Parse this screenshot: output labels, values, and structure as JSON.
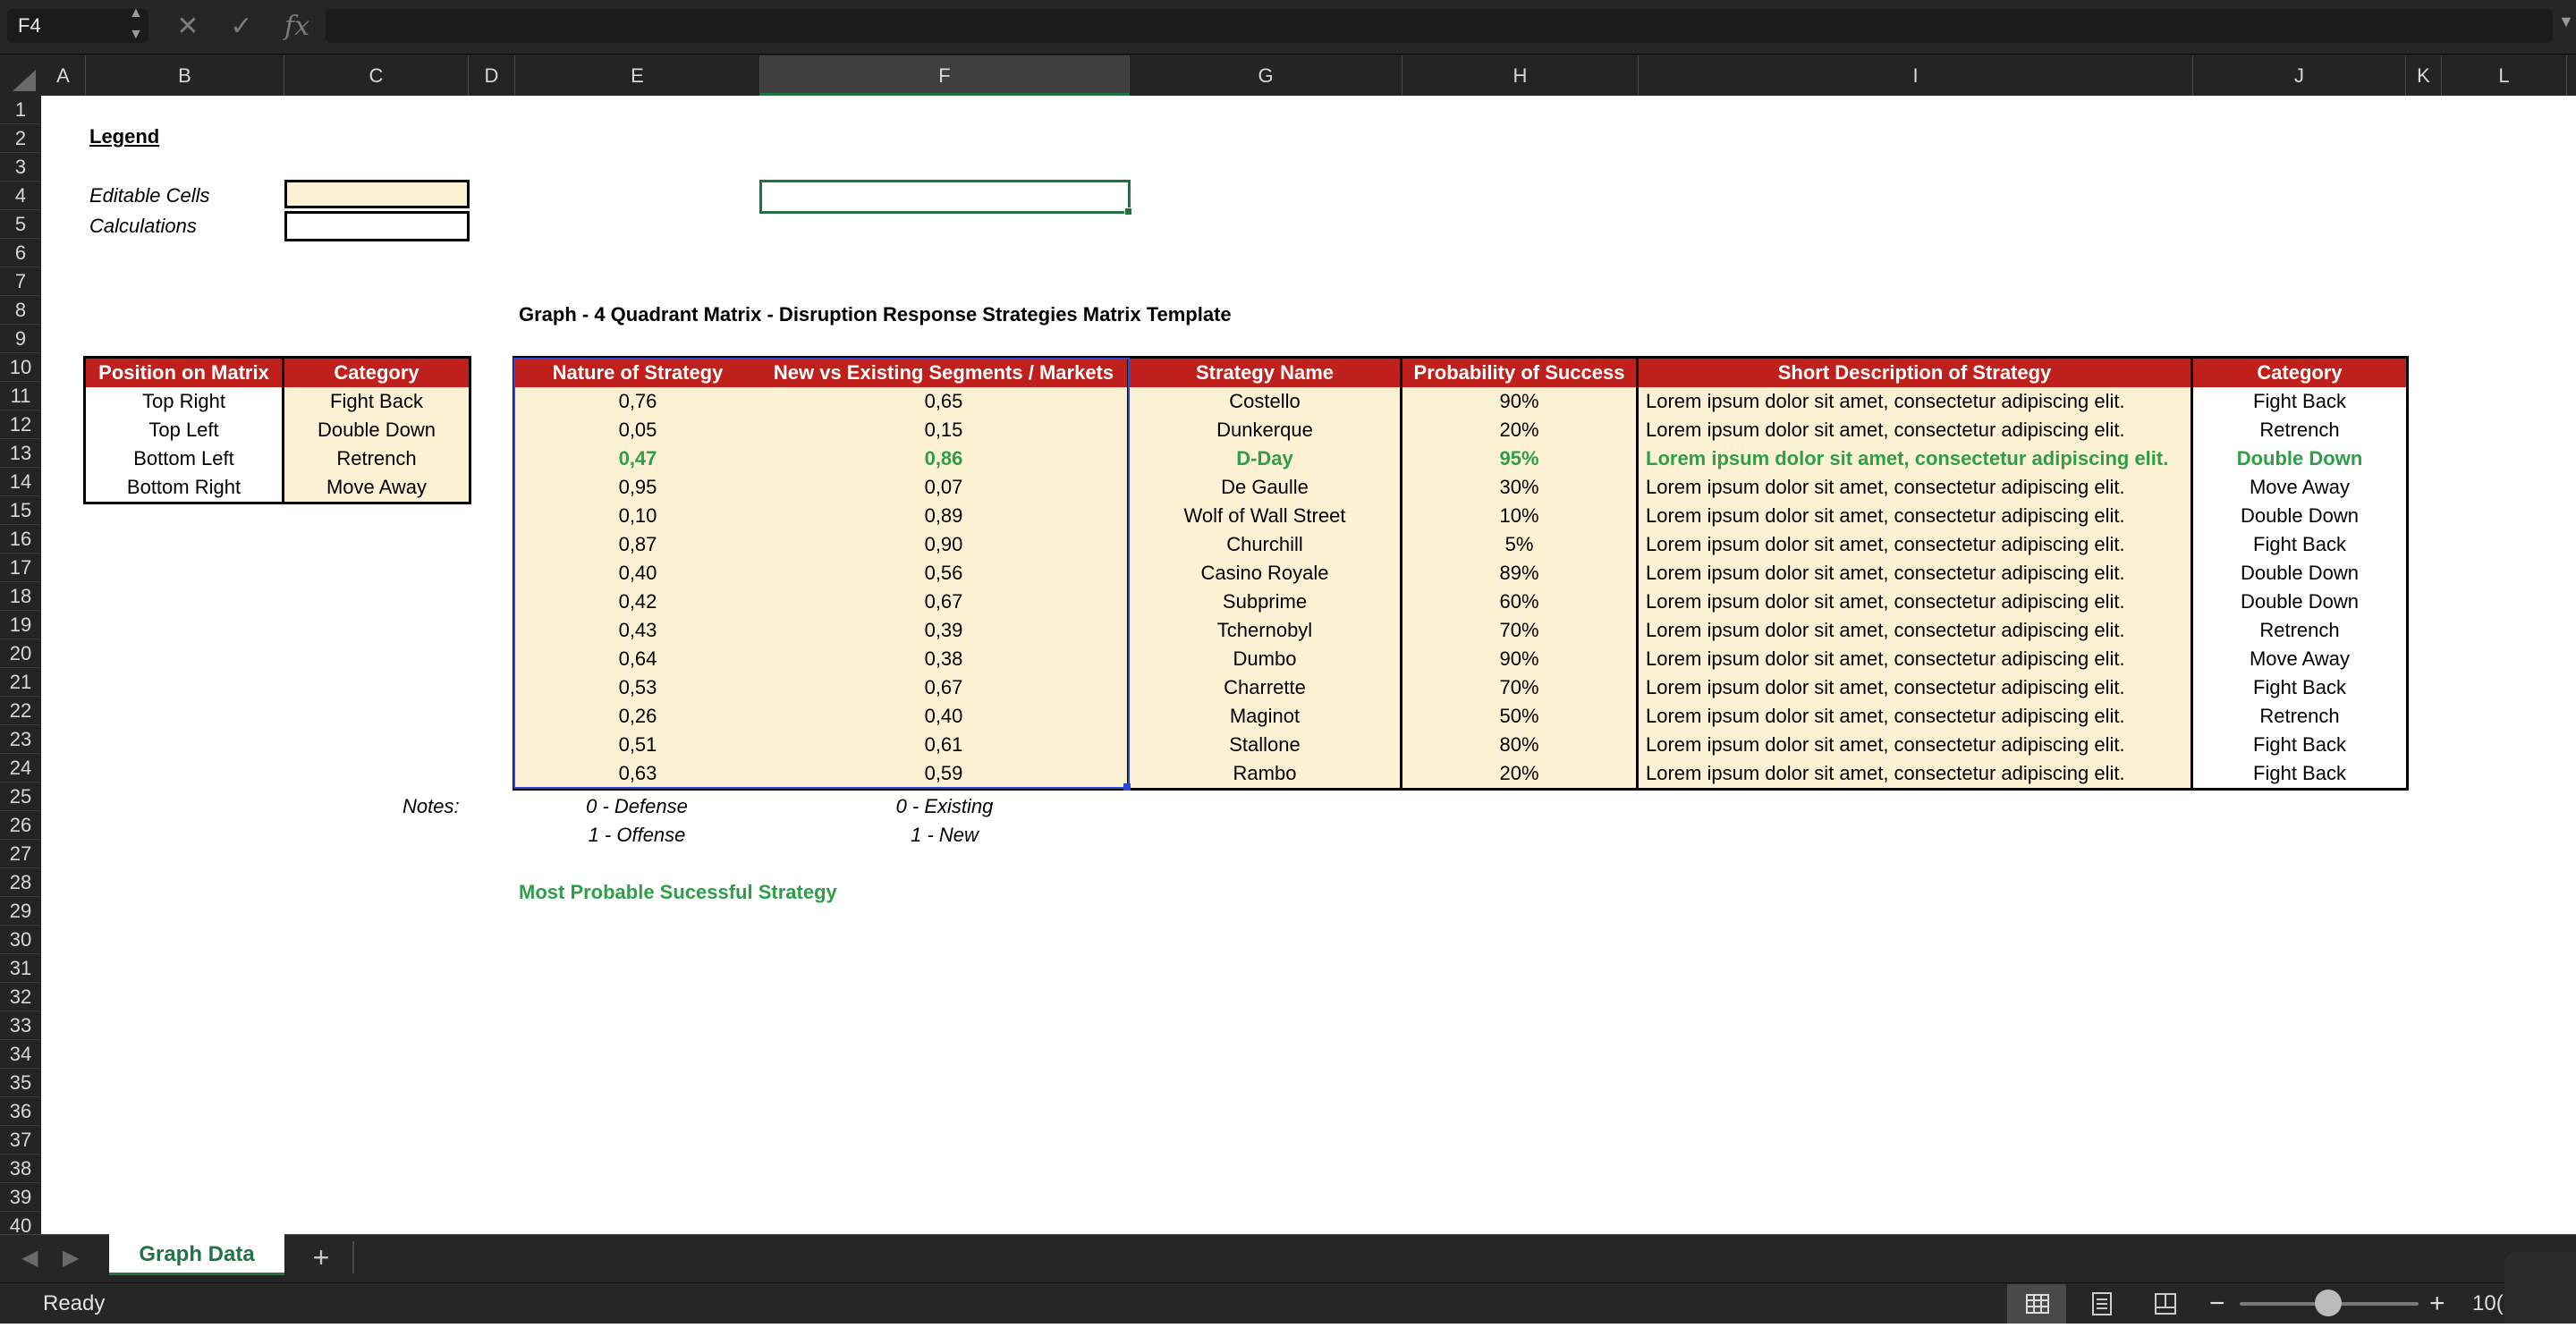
{
  "name_box": "F4",
  "columns": [
    "A",
    "B",
    "C",
    "D",
    "E",
    "F",
    "G",
    "H",
    "I",
    "J",
    "K",
    "L"
  ],
  "rows": [
    "1",
    "2",
    "3",
    "4",
    "5",
    "6",
    "7",
    "8",
    "9",
    "10",
    "11",
    "12",
    "13",
    "14",
    "15",
    "16",
    "17",
    "18",
    "19",
    "20",
    "21",
    "22",
    "23",
    "24",
    "25",
    "26",
    "27",
    "28",
    "29",
    "30",
    "31",
    "32",
    "33",
    "34",
    "35",
    "36",
    "37",
    "38",
    "39",
    "40"
  ],
  "legend": {
    "title": "Legend",
    "editable": "Editable Cells",
    "calculations": "Calculations"
  },
  "graph_title": "Graph - 4 Quadrant Matrix  - Disruption Response Strategies Matrix Template",
  "position_table": {
    "headers": [
      "Position on Matrix",
      "Category"
    ],
    "rows": [
      [
        "Top Right",
        "Fight Back"
      ],
      [
        "Top Left",
        "Double Down"
      ],
      [
        "Bottom Left",
        "Retrench"
      ],
      [
        "Bottom Right",
        "Move Away"
      ]
    ]
  },
  "strategy_table": {
    "headers": [
      "Nature of Strategy",
      "New vs Existing Segments / Markets",
      "Strategy Name",
      "Probability of Success",
      "Short Description of Strategy",
      "Category"
    ],
    "rows": [
      [
        "0,76",
        "0,65",
        "Costello",
        "90%",
        "Lorem ipsum dolor sit amet, consectetur adipiscing elit.",
        "Fight Back"
      ],
      [
        "0,05",
        "0,15",
        "Dunkerque",
        "20%",
        "Lorem ipsum dolor sit amet, consectetur adipiscing elit.",
        "Retrench"
      ],
      [
        "0,47",
        "0,86",
        "D-Day",
        "95%",
        "Lorem ipsum dolor sit amet, consectetur adipiscing elit.",
        "Double Down"
      ],
      [
        "0,95",
        "0,07",
        "De Gaulle",
        "30%",
        "Lorem ipsum dolor sit amet, consectetur adipiscing elit.",
        "Move Away"
      ],
      [
        "0,10",
        "0,89",
        "Wolf of Wall Street",
        "10%",
        "Lorem ipsum dolor sit amet, consectetur adipiscing elit.",
        "Double Down"
      ],
      [
        "0,87",
        "0,90",
        "Churchill",
        "5%",
        "Lorem ipsum dolor sit amet, consectetur adipiscing elit.",
        "Fight Back"
      ],
      [
        "0,40",
        "0,56",
        "Casino Royale",
        "89%",
        "Lorem ipsum dolor sit amet, consectetur adipiscing elit.",
        "Double Down"
      ],
      [
        "0,42",
        "0,67",
        "Subprime",
        "60%",
        "Lorem ipsum dolor sit amet, consectetur adipiscing elit.",
        "Double Down"
      ],
      [
        "0,43",
        "0,39",
        "Tchernobyl",
        "70%",
        "Lorem ipsum dolor sit amet, consectetur adipiscing elit.",
        "Retrench"
      ],
      [
        "0,64",
        "0,38",
        "Dumbo",
        "90%",
        "Lorem ipsum dolor sit amet, consectetur adipiscing elit.",
        "Move Away"
      ],
      [
        "0,53",
        "0,67",
        "Charrette",
        "70%",
        "Lorem ipsum dolor sit amet, consectetur adipiscing elit.",
        "Fight Back"
      ],
      [
        "0,26",
        "0,40",
        "Maginot",
        "50%",
        "Lorem ipsum dolor sit amet, consectetur adipiscing elit.",
        "Retrench"
      ],
      [
        "0,51",
        "0,61",
        "Stallone",
        "80%",
        "Lorem ipsum dolor sit amet, consectetur adipiscing elit.",
        "Fight Back"
      ],
      [
        "0,63",
        "0,59",
        "Rambo",
        "20%",
        "Lorem ipsum dolor sit amet, consectetur adipiscing elit.",
        "Fight Back"
      ]
    ],
    "highlight_row_index": 2
  },
  "notes": {
    "label": "Notes:",
    "nature_line1": "0 - Defense",
    "nature_line2": "1 - Offense",
    "segments_line1": "0 - Existing",
    "segments_line2": "1 - New"
  },
  "most_probable_label": "Most Probable Sucessful Strategy",
  "sheet_tab": "Graph Data",
  "add_sheet": "+",
  "status_text": "Ready",
  "zoom_text": "10(",
  "colors": {
    "header_red": "#c0201c",
    "cream": "#fcf1d2",
    "highlight_green": "#2e9e48",
    "selection_green": "#217346",
    "selection_blue": "#2b4bd6"
  }
}
